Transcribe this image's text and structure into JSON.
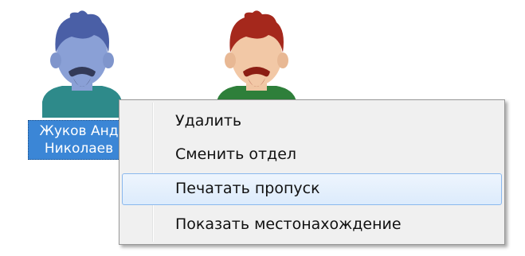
{
  "employee": {
    "name_line1": "Жуков Анд",
    "name_line2": "Николаев"
  },
  "context_menu": {
    "items": [
      {
        "label": "Удалить",
        "state": "normal"
      },
      {
        "label": "Сменить отдел",
        "state": "normal"
      },
      {
        "label": "Печатать пропуск",
        "state": "hover"
      },
      {
        "label": "Показать местонахождение",
        "state": "normal"
      }
    ]
  },
  "icons": {
    "selected_avatar": "employee-avatar-blue-icon",
    "other_avatar": "employee-avatar-red-icon"
  },
  "colors": {
    "selection_bg": "#3b86d6",
    "menu_bg": "#f0f0f0",
    "menu_hover_border": "#8ab8ee",
    "avatar_blue": "#6f88c4",
    "avatar_red": "#a5281c"
  }
}
